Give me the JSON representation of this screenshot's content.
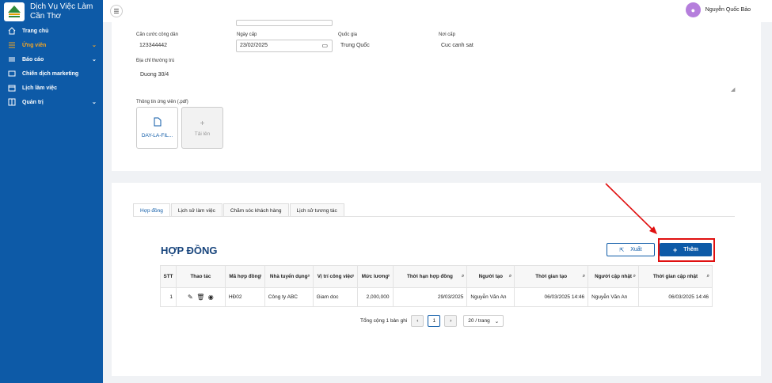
{
  "brand": {
    "title_line1": "Dịch Vụ Việc Làm",
    "title_line2": "Cần Thơ"
  },
  "sidebar": {
    "items": [
      {
        "label": "Trang chủ",
        "icon": "home-icon"
      },
      {
        "label": "Ứng viên",
        "icon": "list-icon",
        "active": true
      },
      {
        "label": "Báo cáo",
        "icon": "report-icon"
      },
      {
        "label": "Chiến dịch marketing",
        "icon": "campaign-icon"
      },
      {
        "label": "Lịch làm việc",
        "icon": "calendar-icon"
      },
      {
        "label": "Quản trị",
        "icon": "admin-icon"
      }
    ]
  },
  "user": {
    "name": "Nguyễn Quốc Bảo"
  },
  "form": {
    "id_label": "Căn cước công dân",
    "id_value": "123344442",
    "issue_date_label": "Ngày cấp",
    "issue_date_value": "23/02/2025",
    "country_label": "Quốc gia",
    "country_value": "Trung Quốc",
    "issue_place_label": "Nơi cấp",
    "issue_place_value": "Cuc canh sat",
    "address_label": "Địa chỉ thường trú",
    "address_value": "Duong 30/4",
    "attachment_label": "Thông tin ứng viên (.pdf)",
    "file_name": "DAY-LA-FIL...",
    "upload_label": "Tải lên"
  },
  "tabs": [
    "Hợp đồng",
    "Lịch sử làm việc",
    "Chăm sóc khách hàng",
    "Lịch sử tương tác"
  ],
  "section_title": "HỢP ĐỒNG",
  "buttons": {
    "export": "Xuất",
    "add": "Thêm"
  },
  "table": {
    "headers": [
      "STT",
      "Thao tác",
      "Mã hợp đồng",
      "Nhà tuyển dụng",
      "Vị trí công việc",
      "Mức lương",
      "Thời hạn hợp đồng",
      "Người tạo",
      "Thời gian tạo",
      "Người cập nhật",
      "Thời gian cập nhật"
    ],
    "rows": [
      [
        "1",
        "",
        "HĐ02",
        "Công ty ABC",
        "Giam doc",
        "2,000,000",
        "29/03/2025",
        "Nguyễn Văn An",
        "06/03/2025 14:46",
        "Nguyễn Văn An",
        "06/03/2025 14:46"
      ]
    ]
  },
  "pagination": {
    "total": "Tổng cộng 1 bản ghi",
    "page": "1",
    "page_size": "20 / trang"
  },
  "colors": {
    "primary": "#0d5aa7",
    "active_nav": "#f5a623",
    "highlight": "#e01010"
  }
}
